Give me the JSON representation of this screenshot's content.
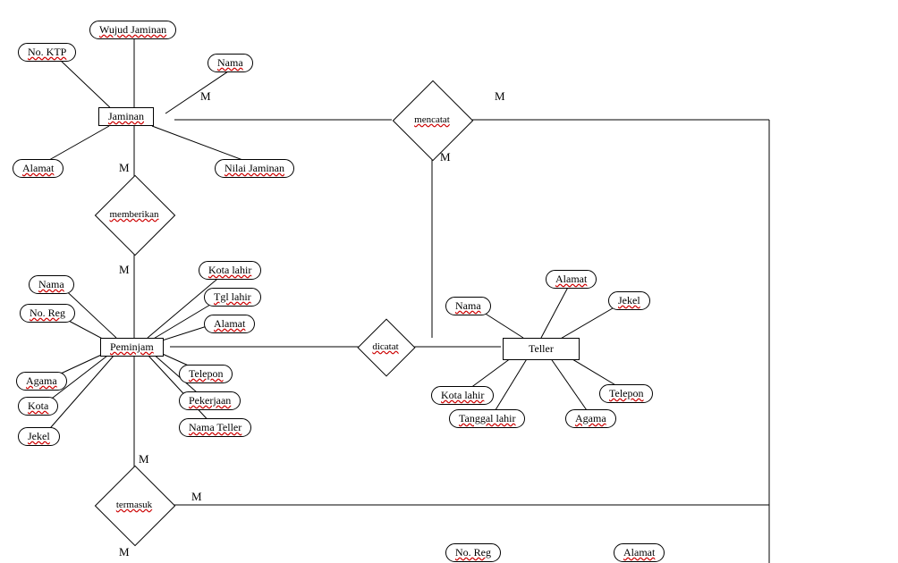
{
  "entities": {
    "jaminan": "Jaminan",
    "peminjam": "Peminjam",
    "teller": "Teller"
  },
  "relationships": {
    "mencatat": "mencatat",
    "memberikan": "memberikan",
    "dicatat": "dicatat",
    "termasuk": "termasuk"
  },
  "attributes": {
    "jaminan": {
      "wujud_jaminan": "Wujud Jaminan",
      "no_ktp": "No. KTP",
      "nama": "Nama",
      "alamat": "Alamat",
      "nilai_jaminan": "Nilai Jaminan"
    },
    "peminjam": {
      "nama": "Nama",
      "no_reg": "No. Reg",
      "kota_lahir": "Kota lahir",
      "tgl_lahir": "Tgl lahir",
      "alamat": "Alamat",
      "telepon": "Telepon",
      "pekerjaan": "Pekerjaan",
      "nama_teller": "Nama Teller",
      "agama": "Agama",
      "kota": "Kota",
      "jekel": "Jekel"
    },
    "teller": {
      "nama": "Nama",
      "alamat": "Alamat",
      "jekel": "Jekel",
      "kota_lahir": "Kota lahir",
      "telepon": "Telepon",
      "tanggal_lahir": "Tanggal lahir",
      "agama": "Agama"
    },
    "bottom": {
      "no_reg": "No. Reg",
      "alamat": "Alamat"
    }
  },
  "cardinalities": {
    "m": "M"
  },
  "chart_data": {
    "type": "er-diagram",
    "entities": [
      {
        "name": "Jaminan",
        "attributes": [
          "Wujud Jaminan",
          "No. KTP",
          "Nama",
          "Alamat",
          "Nilai Jaminan"
        ]
      },
      {
        "name": "Peminjam",
        "attributes": [
          "Nama",
          "No. Reg",
          "Kota lahir",
          "Tgl lahir",
          "Alamat",
          "Telepon",
          "Pekerjaan",
          "Nama Teller",
          "Agama",
          "Kota",
          "Jekel"
        ]
      },
      {
        "name": "Teller",
        "attributes": [
          "Nama",
          "Alamat",
          "Jekel",
          "Kota lahir",
          "Telepon",
          "Tanggal lahir",
          "Agama"
        ]
      }
    ],
    "relationships": [
      {
        "name": "mencatat",
        "between": [
          "Jaminan",
          "Teller"
        ],
        "cardinality": [
          "M",
          "M"
        ]
      },
      {
        "name": "memberikan",
        "between": [
          "Jaminan",
          "Peminjam"
        ],
        "cardinality": [
          "M",
          "M"
        ]
      },
      {
        "name": "dicatat",
        "between": [
          "Peminjam",
          "Teller"
        ],
        "cardinality": [
          "",
          ""
        ]
      },
      {
        "name": "termasuk",
        "between": [
          "Peminjam",
          "?"
        ],
        "cardinality": [
          "M",
          "M",
          "M"
        ]
      }
    ],
    "partial_attributes_visible": [
      "No. Reg",
      "Alamat"
    ]
  }
}
